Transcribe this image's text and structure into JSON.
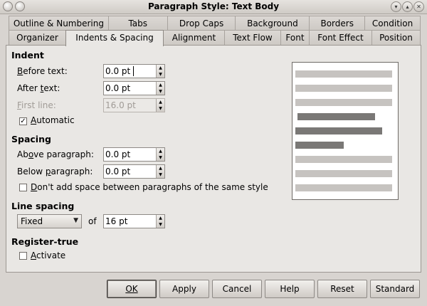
{
  "window": {
    "title": "Paragraph Style: Text Body",
    "menu_icon": "window-menu-icon",
    "controls": [
      "minimize-icon",
      "maximize-icon",
      "close-icon"
    ]
  },
  "tabs": {
    "row1": [
      "Outline & Numbering",
      "Tabs",
      "Drop Caps",
      "Background",
      "Borders",
      "Condition"
    ],
    "row2": [
      "Organizer",
      "Indents & Spacing",
      "Alignment",
      "Text Flow",
      "Font",
      "Font Effect",
      "Position"
    ],
    "active": "Indents & Spacing"
  },
  "indent": {
    "heading": "Indent",
    "before_text": {
      "label_pre": "B",
      "label_post": "efore text:",
      "value": "0.0 pt"
    },
    "after_text": {
      "label_pre": "After ",
      "label_mid": "t",
      "label_post": "ext:",
      "value": "0.0 pt"
    },
    "first_line": {
      "label_pre": "F",
      "label_post": "irst line:",
      "value": "16.0 pt"
    },
    "automatic": {
      "label_pre": "A",
      "label_post": "utomatic",
      "checked": true
    }
  },
  "spacing": {
    "heading": "Spacing",
    "above": {
      "label_pre": "Ab",
      "label_mid": "o",
      "label_post": "ve paragraph:",
      "value": "0.0 pt"
    },
    "below": {
      "label_pre": "Below ",
      "label_mid": "p",
      "label_post": "aragraph:",
      "value": "0.0 pt"
    },
    "dont_add": {
      "label_pre": "D",
      "label_post": "on't add space between paragraphs of the same style",
      "checked": false
    }
  },
  "line_spacing": {
    "heading": "Line spacing",
    "mode": "Fixed",
    "of_label": "of",
    "value": "16 pt"
  },
  "register_true": {
    "heading": "Register-true",
    "activate": {
      "label_pre": "A",
      "label_post": "ctivate",
      "checked": false
    }
  },
  "buttons": {
    "ok": "OK",
    "apply": "Apply",
    "cancel": "Cancel",
    "help": "Help",
    "reset": "Reset",
    "standard": "Standard"
  },
  "colors": {
    "dialog_bg": "#d8d4d0",
    "preview_light": "#c6c3c0",
    "preview_dark": "#7a7876"
  }
}
